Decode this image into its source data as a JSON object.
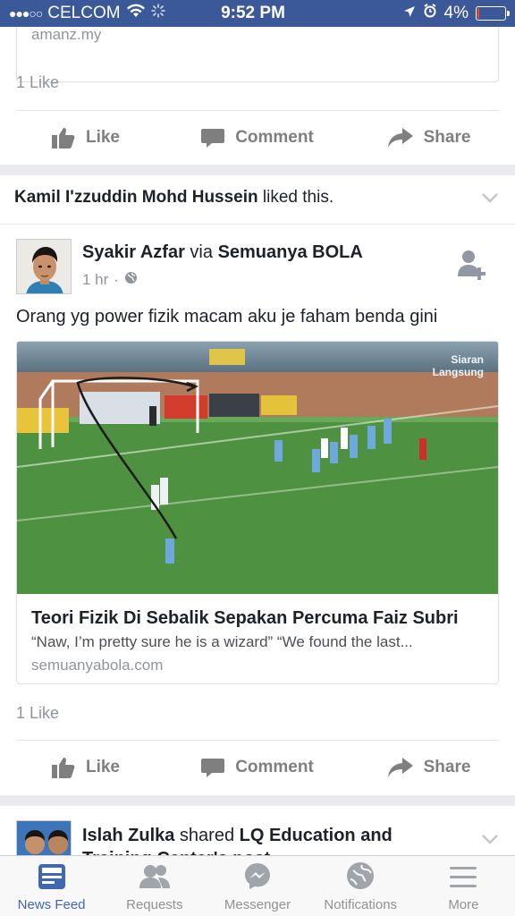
{
  "status_bar": {
    "signal_dots": "●●●○○",
    "carrier": "CELCOM",
    "time": "9:52 PM",
    "battery_percent": "4%",
    "battery_level": 0.04
  },
  "post1": {
    "link_domain": "amanz.my",
    "likes": "1 Like",
    "actions": {
      "like": "Like",
      "comment": "Comment",
      "share": "Share"
    }
  },
  "liked_notice": {
    "actor": "Kamil I'zzuddin Mohd Hussein",
    "verb": " liked this."
  },
  "post2": {
    "author": "Syakir Azfar",
    "via": " via ",
    "page": "Semuanya BOLA",
    "time": "1 hr",
    "separator": "·",
    "text": "Orang yg power fizik macam aku je faham benda gini",
    "link": {
      "image_overlay": "Siaran\nLangsung",
      "title": "Teori Fizik Di Sebalik Sepakan Percuma Faiz Subri",
      "description": "“Naw, I’m pretty sure he is a wizard” “We found the last...",
      "domain": "semuanyabola.com"
    },
    "likes": "1 Like",
    "actions": {
      "like": "Like",
      "comment": "Comment",
      "share": "Share"
    }
  },
  "post3": {
    "author": "Islah Zulka",
    "verb": " shared ",
    "page": "LQ Education and Training Center's post."
  },
  "tab_bar": {
    "tabs": [
      {
        "label": "News Feed",
        "icon": "news-feed-icon",
        "active": true
      },
      {
        "label": "Requests",
        "icon": "requests-icon",
        "active": false
      },
      {
        "label": "Messenger",
        "icon": "messenger-icon",
        "active": false
      },
      {
        "label": "Notifications",
        "icon": "notifications-icon",
        "active": false
      },
      {
        "label": "More",
        "icon": "more-icon",
        "active": false
      }
    ]
  },
  "colors": {
    "brand": "#3b5998",
    "active_tab": "#4267b2",
    "battery_low": "#ff3b30",
    "action_gray": "#7f7f7f",
    "pitch_green": "#4e9141"
  }
}
